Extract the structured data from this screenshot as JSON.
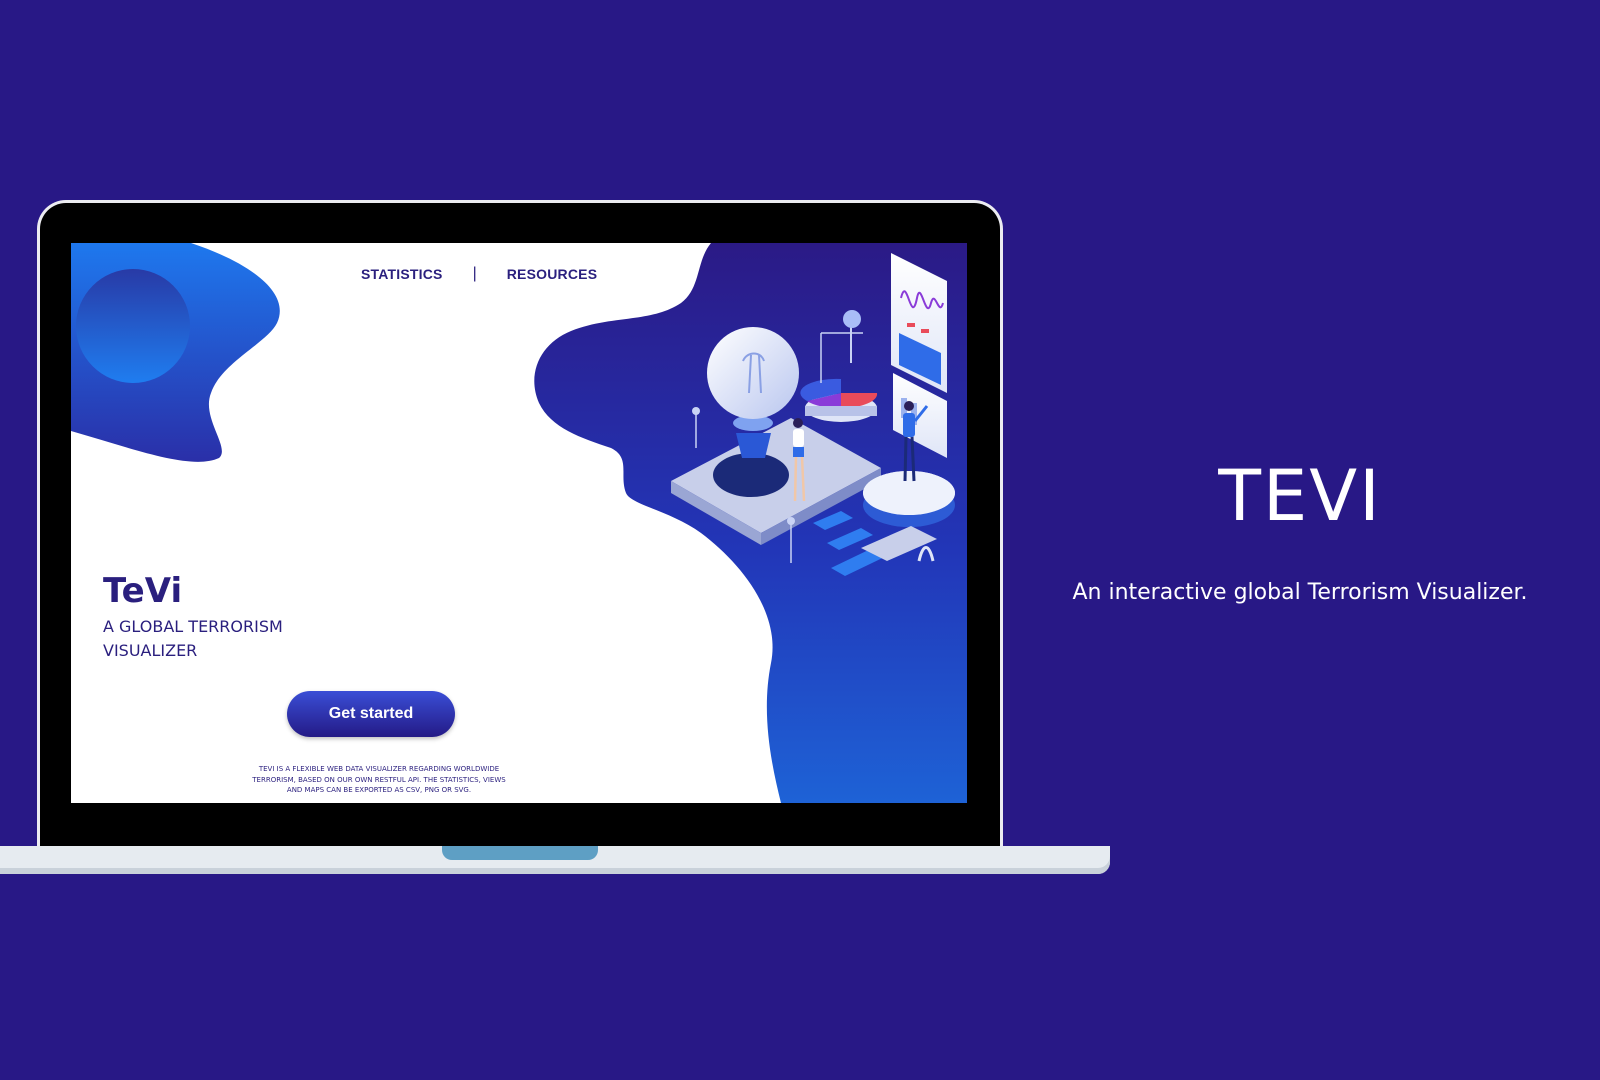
{
  "colors": {
    "page_background": "#281886",
    "brand_dark": "#2a1f7e",
    "accent_blue": "#1f5fe0"
  },
  "site": {
    "nav": {
      "statistics": "STATISTICS",
      "separator": "|",
      "resources": "RESOURCES"
    },
    "brand": "TeVi",
    "tagline": "A GLOBAL TERRORISM VISUALIZER",
    "cta_label": "Get started",
    "description": "TEVI IS A FLEXIBLE WEB DATA VISUALIZER REGARDING WORLDWIDE TERRORISM, BASED ON OUR OWN RESTFUL API. THE STATISTICS, VIEWS AND MAPS CAN BE EXPORTED AS CSV, PNG OR SVG."
  },
  "hero": {
    "title": "TEVI",
    "subtitle": "An interactive global Terrorism Visualizer."
  },
  "icons": {
    "illustration": "isometric-data-illustration",
    "decor_circle": "blue-circle-decoration"
  }
}
